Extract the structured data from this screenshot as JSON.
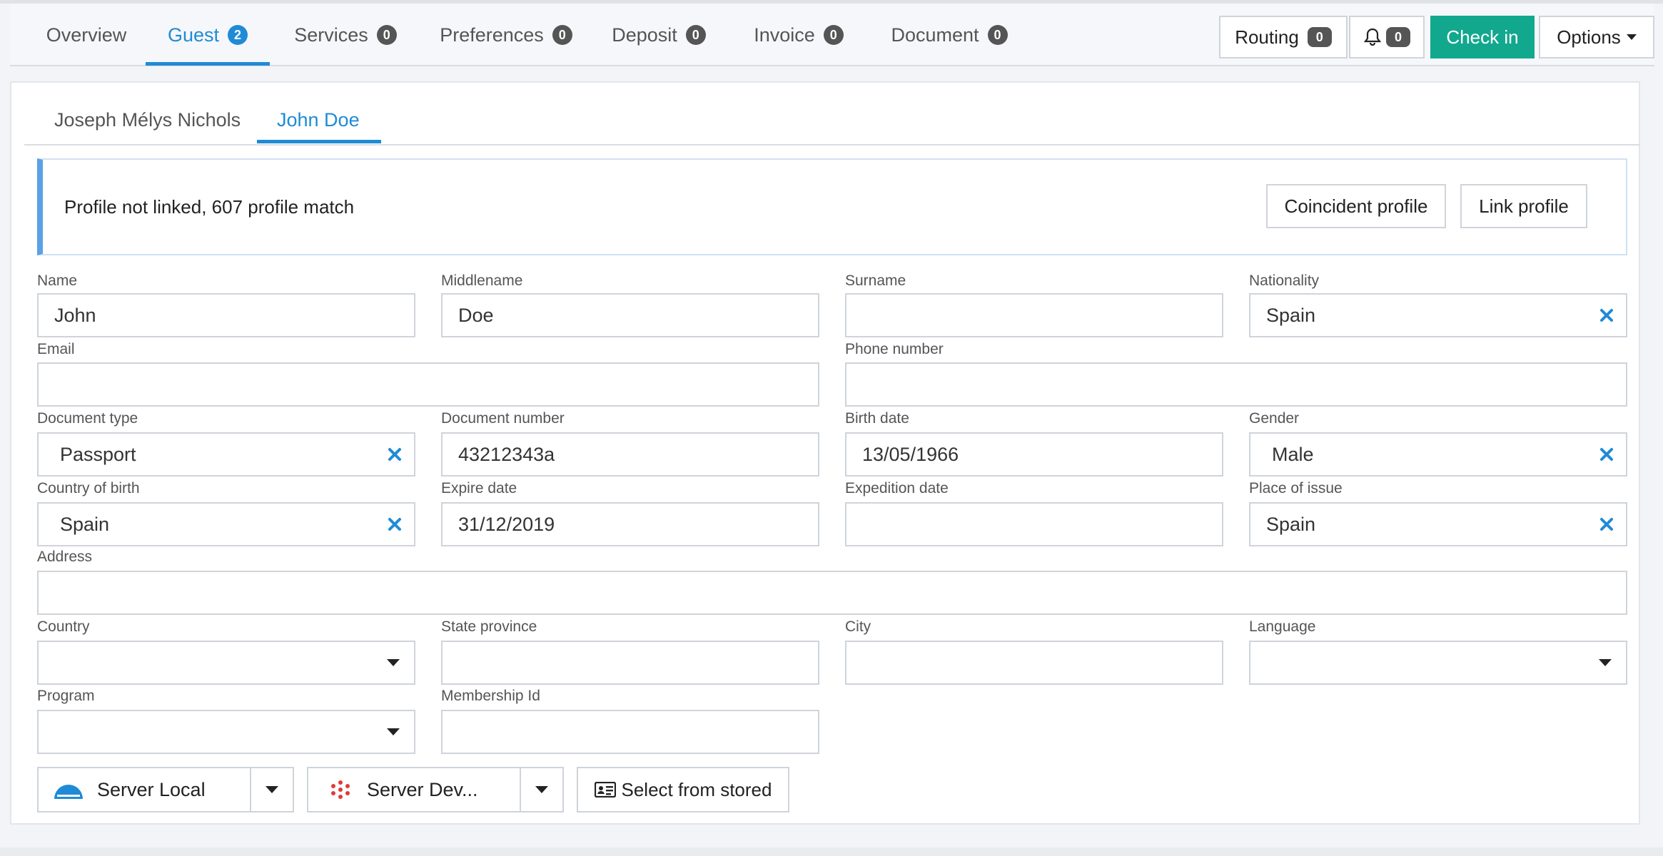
{
  "tabs": [
    {
      "label": "Overview",
      "count": ""
    },
    {
      "label": "Guest",
      "count": "2"
    },
    {
      "label": "Services",
      "count": "0"
    },
    {
      "label": "Preferences",
      "count": "0"
    },
    {
      "label": "Deposit",
      "count": "0"
    },
    {
      "label": "Invoice",
      "count": "0"
    },
    {
      "label": "Document",
      "count": "0"
    }
  ],
  "toolbar": {
    "routing_label": "Routing",
    "routing_count": "0",
    "notifications_count": "0",
    "checkin_label": "Check in",
    "options_label": "Options"
  },
  "guests": [
    {
      "label": "Joseph Mélys Nichols"
    },
    {
      "label": "John Doe"
    }
  ],
  "alert": {
    "text": "Profile not linked, 607 profile match",
    "coincident_label": "Coincident profile",
    "link_label": "Link profile"
  },
  "form": {
    "name": {
      "label": "Name",
      "value": "John"
    },
    "middlename": {
      "label": "Middlename",
      "value": "Doe"
    },
    "surname": {
      "label": "Surname",
      "value": ""
    },
    "nationality": {
      "label": "Nationality",
      "value": "Spain"
    },
    "email": {
      "label": "Email",
      "value": ""
    },
    "phone": {
      "label": "Phone number",
      "value": ""
    },
    "document_type": {
      "label": "Document type",
      "value": "Passport"
    },
    "document_number": {
      "label": "Document number",
      "value": "43212343a"
    },
    "birth_date": {
      "label": "Birth date",
      "value": "13/05/1966"
    },
    "gender": {
      "label": "Gender",
      "value": "Male"
    },
    "country_of_birth": {
      "label": "Country of birth",
      "value": "Spain"
    },
    "expire_date": {
      "label": "Expire date",
      "value": "31/12/2019"
    },
    "expedition_date": {
      "label": "Expedition date",
      "value": ""
    },
    "place_of_issue": {
      "label": "Place of issue",
      "value": "Spain"
    },
    "address": {
      "label": "Address",
      "value": ""
    },
    "country": {
      "label": "Country",
      "value": ""
    },
    "state_province": {
      "label": "State province",
      "value": ""
    },
    "city": {
      "label": "City",
      "value": ""
    },
    "language": {
      "label": "Language",
      "value": ""
    },
    "program": {
      "label": "Program",
      "value": ""
    },
    "membership_id": {
      "label": "Membership Id",
      "value": ""
    }
  },
  "actions": {
    "server_local_label": "Server Local",
    "server_dev_label": "Server Dev...",
    "select_stored_label": "Select from stored"
  },
  "colors": {
    "accent": "#1f8bd6",
    "checkin_green": "#12a88e",
    "clear_icon": "#1f8bd6",
    "alert_border": "#5aa1e6"
  }
}
